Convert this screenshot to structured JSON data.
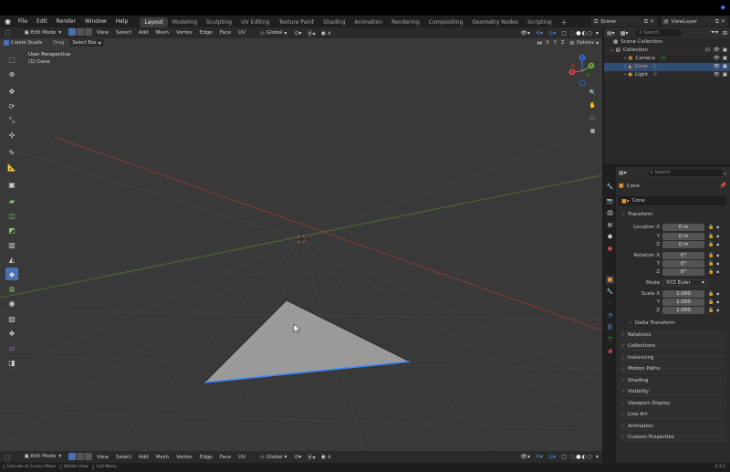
{
  "menubar": {
    "items": [
      "File",
      "Edit",
      "Render",
      "Window",
      "Help"
    ],
    "workspaces": [
      "Layout",
      "Modeling",
      "Sculpting",
      "UV Editing",
      "Texture Paint",
      "Shading",
      "Animation",
      "Rendering",
      "Compositing",
      "Geometry Nodes",
      "Scripting"
    ],
    "active_workspace": "Layout",
    "add_tab": "+",
    "scene": "Scene",
    "view_layer": "ViewLayer"
  },
  "viewport": {
    "mode": "Edit Mode",
    "menus": [
      "View",
      "Select",
      "Add",
      "Mesh",
      "Vertex",
      "Edge",
      "Face",
      "UV"
    ],
    "transform_orientation": "Global",
    "create_quads": "Create Quads",
    "drag_label": "Drag",
    "drag_value": "Select Box",
    "perspective": "User Perspective",
    "object_name": "(1) Cone",
    "options": "Options",
    "axis_labels": [
      "X",
      "Y",
      "Z"
    ],
    "gizmo_axes": [
      "Z",
      "Y",
      "X"
    ]
  },
  "footer": {
    "mode": "Edit Mode",
    "menus": [
      "View",
      "Select",
      "Add",
      "Mesh",
      "Vertex",
      "Edge",
      "Face",
      "UV"
    ],
    "transform_orientation": "Global"
  },
  "statusbar": {
    "hints": [
      "Extrude at Cursor Move",
      "Rotate View",
      "Call Menu"
    ],
    "version": "4.3.2"
  },
  "outliner": {
    "search_placeholder": "Search",
    "items": [
      {
        "label": "Scene Collection",
        "level": 0
      },
      {
        "label": "Collection",
        "level": 1
      },
      {
        "label": "Camera",
        "level": 2
      },
      {
        "label": "Cone",
        "level": 2,
        "selected": true
      },
      {
        "label": "Light",
        "level": 2
      }
    ]
  },
  "properties": {
    "search_placeholder": "Search",
    "object_name": "Cone",
    "data_name": "Cone",
    "transform_title": "Transform",
    "location_label": "Location X",
    "location": [
      "0 m",
      "0 m",
      "0 m"
    ],
    "rotation_label": "Rotation X",
    "rotation": [
      "0°",
      "0°",
      "0°"
    ],
    "mode_label": "Mode",
    "mode_value": "XYZ Euler",
    "scale_label": "Scale X",
    "scale": [
      "1.000",
      "1.000",
      "1.000"
    ],
    "axis_y": "Y",
    "axis_z": "Z",
    "delta_transform": "Delta Transform",
    "panels": [
      "Relations",
      "Collections",
      "Instancing",
      "Motion Paths",
      "Shading",
      "Visibility",
      "Viewport Display",
      "Line Art",
      "Animation",
      "Custom Properties"
    ]
  },
  "colors": {
    "accent": "#4772b3",
    "grid_red": "#9a3c3c",
    "grid_green": "#5a7a36",
    "selected_edge": "#3d8bff",
    "mesh_face": "#9a9a9a"
  }
}
